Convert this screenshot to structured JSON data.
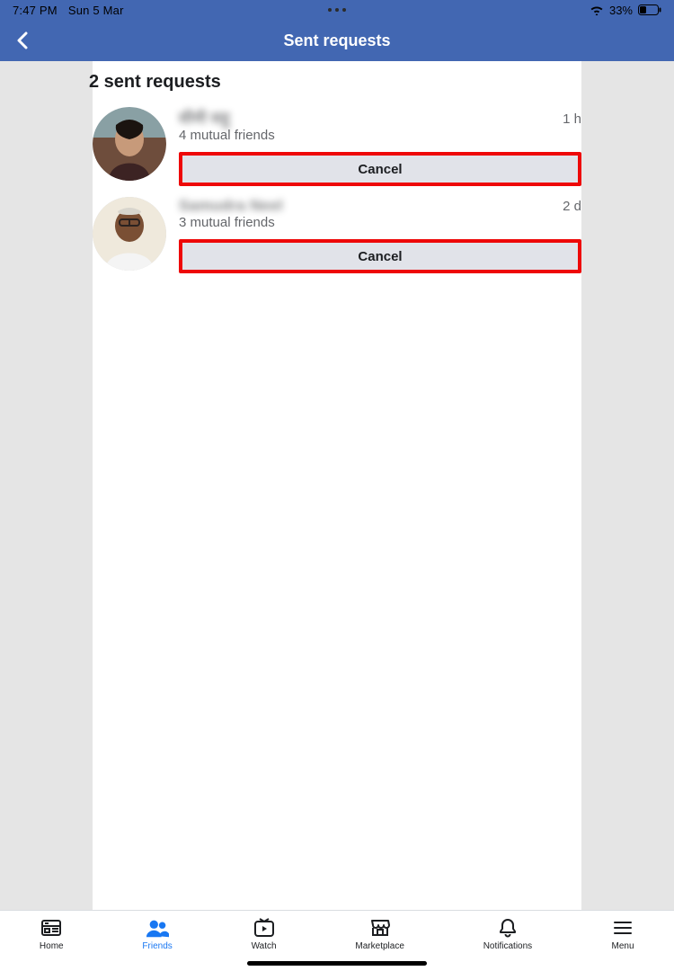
{
  "status_bar": {
    "time": "7:47 PM",
    "date": "Sun 5 Mar",
    "battery_percent": "33%"
  },
  "header": {
    "title": "Sent requests"
  },
  "heading": "2 sent requests",
  "requests": [
    {
      "name": "सीमी सहू",
      "mutual": "4 mutual friends",
      "time": "1 h",
      "button": "Cancel"
    },
    {
      "name": "Samudra Neel",
      "mutual": "3 mutual friends",
      "time": "2 d",
      "button": "Cancel"
    }
  ],
  "tabs": {
    "home": "Home",
    "friends": "Friends",
    "watch": "Watch",
    "marketplace": "Marketplace",
    "notifications": "Notifications",
    "menu": "Menu"
  }
}
